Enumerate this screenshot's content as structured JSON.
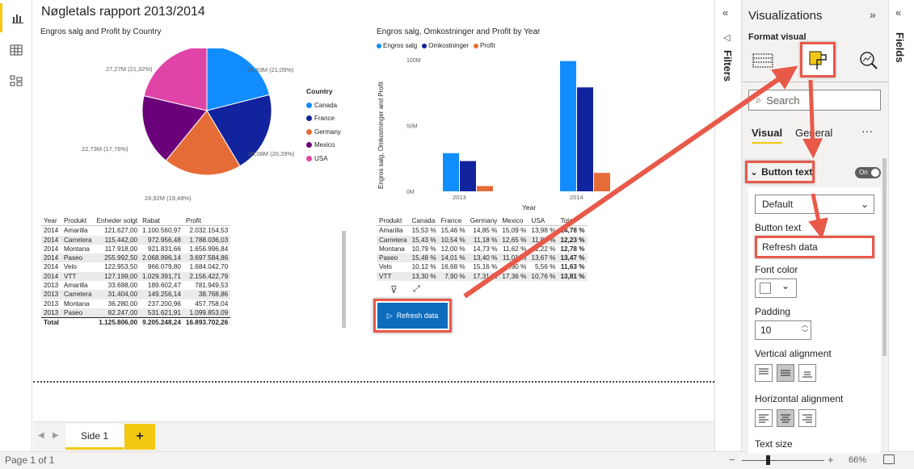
{
  "report": {
    "title": "Nøgletals rapport 2013/2014"
  },
  "pie": {
    "title": "Engros salg and Profit by Country",
    "legend_title": "Country",
    "labels": {
      "canada": "26,93M (21,05%)",
      "france": "26,08M (20,39%)",
      "germany": "24,92M (19,48%)",
      "mexico": "22,73M (17,76%)",
      "usa": "27,27M (21,32%)"
    },
    "legend": [
      "Canada",
      "France",
      "Germany",
      "Mexico",
      "USA"
    ]
  },
  "colors": {
    "canada": "#118DFF",
    "france": "#12239E",
    "germany": "#E66C37",
    "mexico": "#6B007B",
    "usa": "#E044A7",
    "accent": "#F2C811",
    "annotation": "#E8594A",
    "button": "#0F6CBD"
  },
  "chart_data": [
    {
      "type": "pie",
      "title": "Engros salg and Profit by Country",
      "legend_title": "Country",
      "categories": [
        "Canada",
        "France",
        "Germany",
        "Mexico",
        "USA"
      ],
      "values": [
        26.93,
        26.08,
        24.92,
        22.73,
        27.27
      ],
      "percents": [
        21.05,
        20.39,
        19.48,
        17.76,
        21.32
      ],
      "unit": "M"
    },
    {
      "type": "bar",
      "title": "Engros salg, Omkostninger and Profit by Year",
      "xlabel": "Year",
      "ylabel": "Engros salg, Omkostninger and Profit",
      "categories": [
        "2013",
        "2014"
      ],
      "series": [
        {
          "name": "Engros salg",
          "values": [
            29,
            99
          ]
        },
        {
          "name": "Omkostninger",
          "values": [
            23,
            79
          ]
        },
        {
          "name": "Profit",
          "values": [
            4,
            14
          ]
        }
      ],
      "ylim": [
        0,
        100
      ],
      "yticks": [
        "0M",
        "50M",
        "100M"
      ]
    }
  ],
  "bar": {
    "title": "Engros salg, Omkostninger and Profit by Year",
    "legend": [
      "Engros salg",
      "Omkostninger",
      "Profit"
    ],
    "ylabel": "Engros salg, Omkostninger and Profit",
    "xlabel": "Year",
    "yticks": [
      "100M",
      "50M",
      "0M"
    ],
    "xticks": [
      "2013",
      "2014"
    ]
  },
  "table1": {
    "headers": [
      "Year",
      "Produkt",
      "Enheder solgt",
      "Rabat",
      "Profit"
    ],
    "rows": [
      [
        "2014",
        "Amarilla",
        "121.627,00",
        "1.100.560,97",
        "2.032.154,53"
      ],
      [
        "2014",
        "Carretera",
        "115.442,00",
        "972.956,48",
        "1.788.036,03"
      ],
      [
        "2014",
        "Montana",
        "117.918,00",
        "921.831,66",
        "1.656.996,84"
      ],
      [
        "2014",
        "Paseo",
        "255.992,50",
        "2.068.896,14",
        "3.697.584,86"
      ],
      [
        "2014",
        "Velo",
        "122.953,50",
        "966.079,80",
        "1.684.042,70"
      ],
      [
        "2014",
        "VTT",
        "127.199,00",
        "1.029.391,71",
        "2.156.422,79"
      ],
      [
        "2013",
        "Amarilla",
        "33.688,00",
        "189.602,47",
        "781.949,53"
      ],
      [
        "2013",
        "Carretera",
        "31.404,00",
        "149.256,14",
        "38.768,86"
      ],
      [
        "2013",
        "Montana",
        "36.280,00",
        "237.200,96",
        "457.758,04"
      ],
      [
        "2013",
        "Paseo",
        "82.247,00",
        "531.621,91",
        "1.099.853,09"
      ]
    ],
    "total": [
      "Total",
      "",
      "1.125.806,00",
      "9.205.248,24",
      "16.893.702,26"
    ]
  },
  "table2": {
    "headers": [
      "Produkt",
      "Canada",
      "France",
      "Germany",
      "Mexico",
      "USA",
      "Total"
    ],
    "rows": [
      [
        "Amarilla",
        "15,53 %",
        "15,46 %",
        "14,85 %",
        "15,09 %",
        "13,98 %",
        "14,78 %"
      ],
      [
        "Carretera",
        "15,43 %",
        "10,54 %",
        "11,18 %",
        "12,65 %",
        "11,89 %",
        "12,23 %"
      ],
      [
        "Montana",
        "10,79 %",
        "12,00 %",
        "14,73 %",
        "11,62 %",
        "11,22 %",
        "12,78 %"
      ],
      [
        "Paseo",
        "15,48 %",
        "14,01 %",
        "13,40 %",
        "11,01 %",
        "13,67 %",
        "13,47 %"
      ],
      [
        "Velo",
        "10,12 %",
        "16,68 %",
        "15,16 %",
        "6,90 %",
        "5,56 %",
        "11,63 %"
      ],
      [
        "VTT",
        "13,30 %",
        "7,90 %",
        "17,31 %",
        "17,36 %",
        "10,76 %",
        "13,81 %"
      ]
    ]
  },
  "refresh_button": {
    "label": "Refresh data"
  },
  "tabs": {
    "page": "Side 1",
    "add": "+"
  },
  "status": {
    "page_info": "Page 1 of 1",
    "zoom": "66%"
  },
  "filters": {
    "title": "Filters"
  },
  "fields": {
    "title": "Fields"
  },
  "viz": {
    "title": "Visualizations",
    "format_label": "Format visual",
    "search_placeholder": "Search",
    "tab_visual": "Visual",
    "tab_general": "General",
    "more": "···",
    "section": "Button text",
    "toggle": "On",
    "state_select": "Default",
    "button_text_label": "Button text",
    "button_text_value": "Refresh data",
    "font_color_label": "Font color",
    "padding_label": "Padding",
    "padding_value": "10",
    "valign_label": "Vertical alignment",
    "halign_label": "Horizontal alignment",
    "text_size_label": "Text size"
  }
}
